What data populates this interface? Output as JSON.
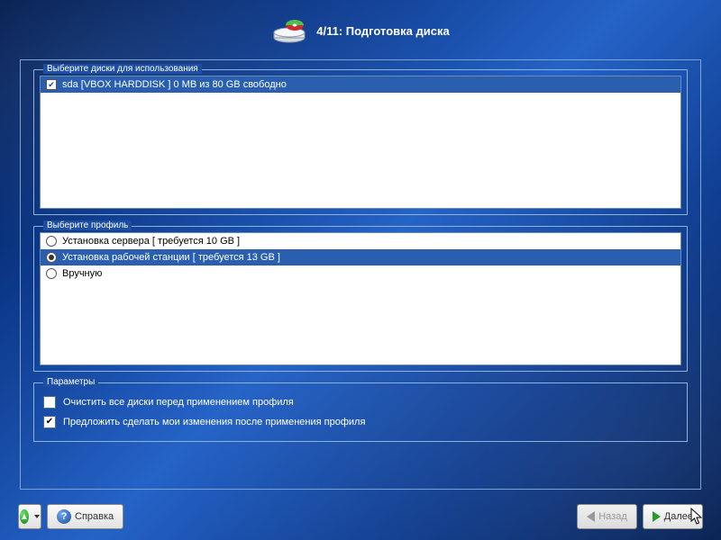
{
  "header": {
    "step_current": 4,
    "step_total": 11,
    "title": "4/11: Подготовка диска"
  },
  "disks_section": {
    "legend": "Выберите диски для использования",
    "items": [
      {
        "checked": true,
        "label": "sda [VBOX HARDDISK   ]  0 MB из 80 GB свободно",
        "selected": true
      }
    ]
  },
  "profile_section": {
    "legend": "Выберите профиль",
    "items": [
      {
        "label": "Установка сервера [ требуется 10 GB ]",
        "selected": false
      },
      {
        "label": "Установка рабочей станции [ требуется 13 GB ]",
        "selected": true
      },
      {
        "label": "Вручную",
        "selected": false
      }
    ]
  },
  "params_section": {
    "legend": "Параметры",
    "items": [
      {
        "checked": false,
        "label": "Очистить все диски перед применением профиля"
      },
      {
        "checked": true,
        "label": "Предложить сделать мои изменения после применения профиля"
      }
    ]
  },
  "footer": {
    "help_label": "Справка",
    "back_label": "Назад",
    "next_label": "Далее",
    "back_enabled": false
  }
}
